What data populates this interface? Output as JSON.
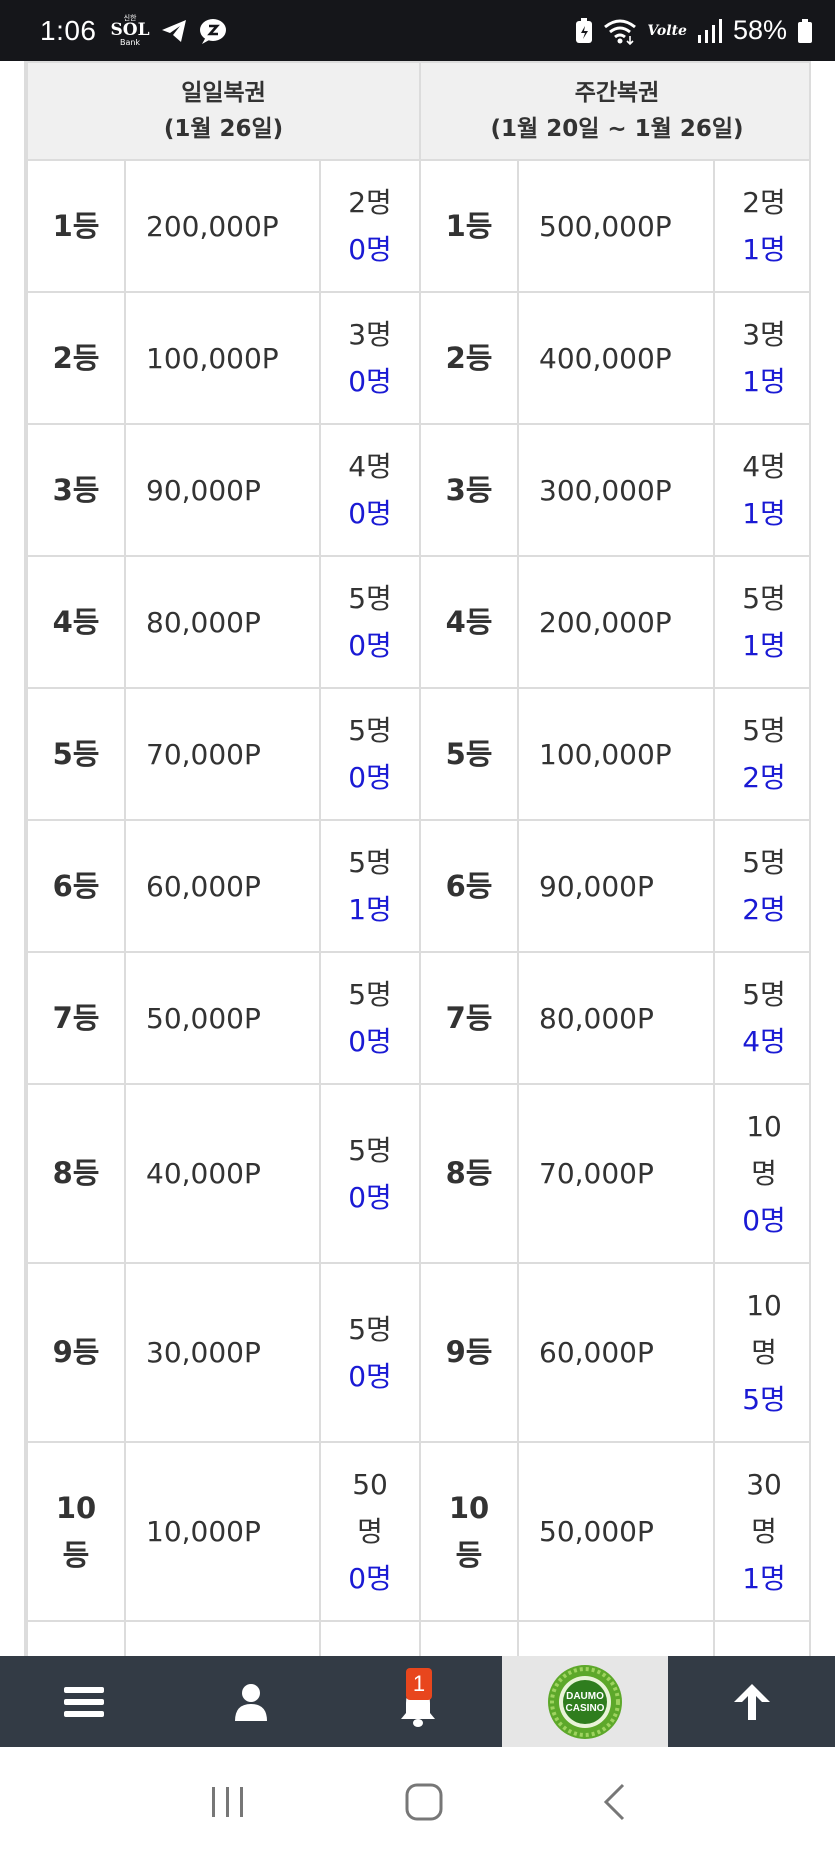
{
  "status_bar": {
    "time": "1:06",
    "sol_top": "신한",
    "sol_main": "SOL",
    "sol_bottom": "Bank",
    "volte": "Volte",
    "battery": "58%"
  },
  "table": {
    "header": {
      "daily_title": "일일복권",
      "daily_period": "(1월 26일)",
      "weekly_title": "주간복권",
      "weekly_period": "(1월 20일 ~ 1월 26일)"
    },
    "rows": [
      {
        "rank": "1등",
        "daily_prize": "200,000P",
        "daily_total": "2명",
        "daily_win": "0명",
        "weekly_prize": "500,000P",
        "weekly_total": "2명",
        "weekly_win": "1명"
      },
      {
        "rank": "2등",
        "daily_prize": "100,000P",
        "daily_total": "3명",
        "daily_win": "0명",
        "weekly_prize": "400,000P",
        "weekly_total": "3명",
        "weekly_win": "1명"
      },
      {
        "rank": "3등",
        "daily_prize": "90,000P",
        "daily_total": "4명",
        "daily_win": "0명",
        "weekly_prize": "300,000P",
        "weekly_total": "4명",
        "weekly_win": "1명"
      },
      {
        "rank": "4등",
        "daily_prize": "80,000P",
        "daily_total": "5명",
        "daily_win": "0명",
        "weekly_prize": "200,000P",
        "weekly_total": "5명",
        "weekly_win": "1명"
      },
      {
        "rank": "5등",
        "daily_prize": "70,000P",
        "daily_total": "5명",
        "daily_win": "0명",
        "weekly_prize": "100,000P",
        "weekly_total": "5명",
        "weekly_win": "2명"
      },
      {
        "rank": "6등",
        "daily_prize": "60,000P",
        "daily_total": "5명",
        "daily_win": "1명",
        "weekly_prize": "90,000P",
        "weekly_total": "5명",
        "weekly_win": "2명"
      },
      {
        "rank": "7등",
        "daily_prize": "50,000P",
        "daily_total": "5명",
        "daily_win": "0명",
        "weekly_prize": "80,000P",
        "weekly_total": "5명",
        "weekly_win": "4명"
      },
      {
        "rank": "8등",
        "daily_prize": "40,000P",
        "daily_total": "5명",
        "daily_win": "0명",
        "weekly_prize": "70,000P",
        "weekly_total_a": "10",
        "weekly_total_b": "명",
        "weekly_win": "0명"
      },
      {
        "rank": "9등",
        "daily_prize": "30,000P",
        "daily_total": "5명",
        "daily_win": "0명",
        "weekly_prize": "60,000P",
        "weekly_total_a": "10",
        "weekly_total_b": "명",
        "weekly_win": "5명"
      },
      {
        "rank_a": "10",
        "rank_b": "등",
        "daily_prize": "10,000P",
        "daily_total_a": "50",
        "daily_total_b": "명",
        "daily_win": "0명",
        "weekly_prize": "50,000P",
        "weekly_total_a": "30",
        "weekly_total_b": "명",
        "weekly_win": "1명"
      }
    ]
  },
  "bottom_nav": {
    "notification_count": "1",
    "logo_line1": "DAUMO",
    "logo_line2": "CASINO"
  },
  "colors": {
    "win_count": "#1a1ad4",
    "header_bg": "#f0f0f0",
    "nav_bg": "#333b45",
    "badge": "#e8461d"
  },
  "icons": [
    "menu-icon",
    "user-icon",
    "bell-icon",
    "arrow-up-icon",
    "recent-apps-icon",
    "home-icon",
    "back-icon"
  ]
}
